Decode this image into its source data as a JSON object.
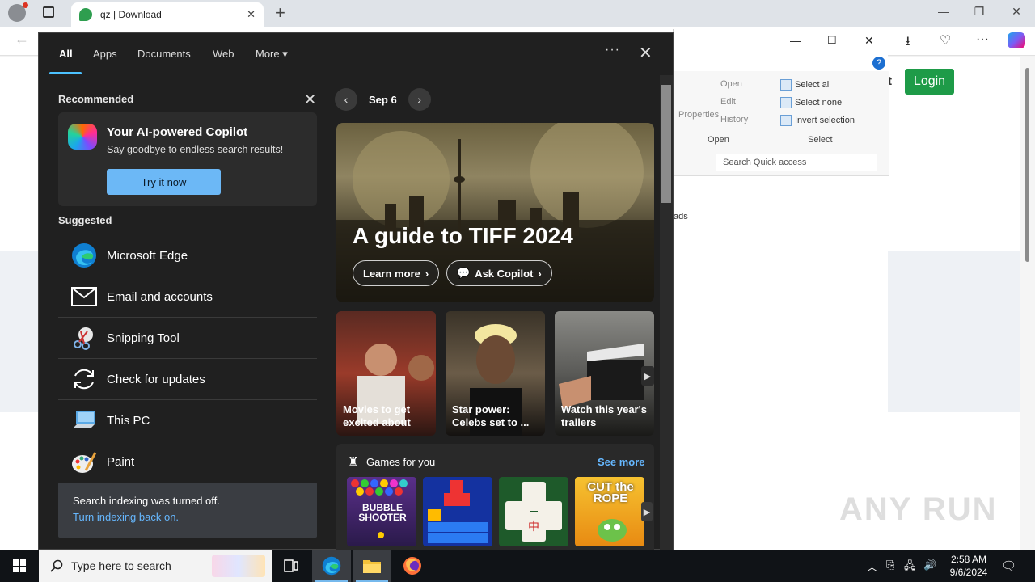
{
  "browser": {
    "tab_title": "qz | Download",
    "tab_close": "✕",
    "new_tab": "+",
    "minimize": "—",
    "restore": "❐",
    "close": "✕",
    "back": "←"
  },
  "page": {
    "login_label": "Login",
    "fragment_t": "t",
    "fragment_ads": "ads"
  },
  "explorer": {
    "properties": "Properties",
    "open": "Open",
    "edit": "Edit",
    "history": "History",
    "select_all": "Select all",
    "select_none": "Select none",
    "invert_selection": "Invert selection",
    "group_open": "Open",
    "group_select": "Select",
    "search_placeholder": "Search Quick access"
  },
  "panel": {
    "tabs": [
      {
        "label": "All",
        "active": true
      },
      {
        "label": "Apps"
      },
      {
        "label": "Documents"
      },
      {
        "label": "Web"
      },
      {
        "label": "More ▾"
      }
    ],
    "dots": "···",
    "close": "✕",
    "recommended_title": "Recommended",
    "copilot": {
      "title": "Your AI-powered Copilot",
      "subtitle": "Say goodbye to endless search results!",
      "button": "Try it now"
    },
    "suggested_title": "Suggested",
    "suggested": [
      {
        "label": "Microsoft Edge",
        "icon": "edge-icon"
      },
      {
        "label": "Email and accounts",
        "icon": "mail-icon"
      },
      {
        "label": "Snipping Tool",
        "icon": "snipping-tool-icon"
      },
      {
        "label": "Check for updates",
        "icon": "refresh-icon"
      },
      {
        "label": "This PC",
        "icon": "computer-icon"
      },
      {
        "label": "Paint",
        "icon": "paint-icon"
      }
    ],
    "indexing": {
      "message": "Search indexing was turned off.",
      "link": "Turn indexing back on."
    },
    "date": "Sep 6",
    "hero": {
      "title": "A guide to TIFF 2024",
      "learn_more": "Learn more",
      "ask_copilot": "Ask Copilot"
    },
    "tiles": [
      {
        "caption": "Movies to get excited about"
      },
      {
        "caption": "Star power: Celebs set to ..."
      },
      {
        "caption": "Watch this year's trailers"
      }
    ],
    "games": {
      "title": "Games for you",
      "see_more": "See more",
      "items": [
        "BUBBLE SHOOTER",
        "",
        "",
        "CUT the ROPE"
      ]
    }
  },
  "taskbar": {
    "search_placeholder": "Type here to search",
    "time": "2:58 AM",
    "date": "9/6/2024"
  },
  "watermark": "ANY RUN"
}
